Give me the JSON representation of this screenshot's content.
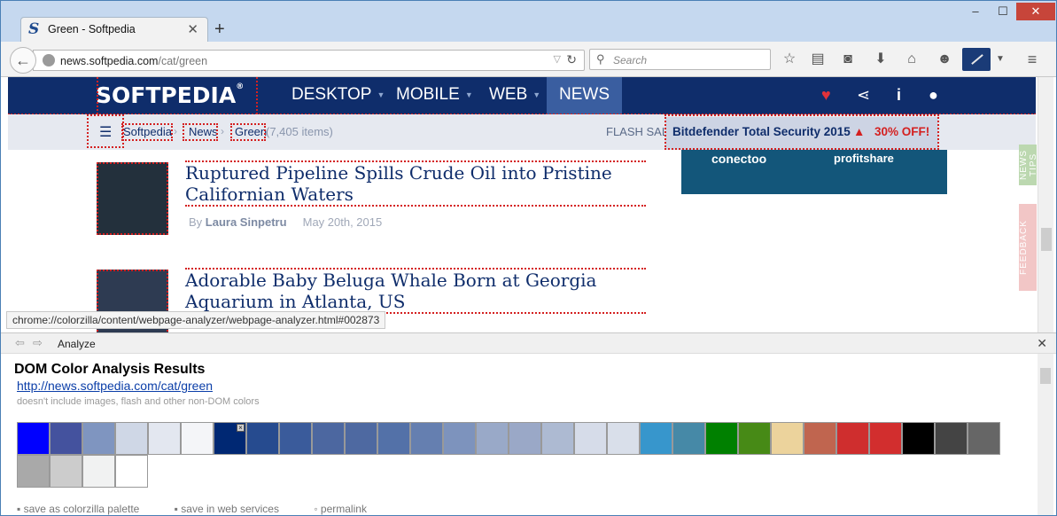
{
  "browser": {
    "tab_title": "Green - Softpedia",
    "tab_favicon": "S",
    "new_tab": "+",
    "url_host": "news.softpedia.com",
    "url_path": "/cat/green",
    "search_placeholder": "Search"
  },
  "site": {
    "logo": "SOFTPEDIA",
    "logo_mark": "®",
    "nav": [
      "DESKTOP",
      "MOBILE",
      "WEB",
      "NEWS"
    ],
    "breadcrumbs": [
      "Softpedia",
      "News",
      "Green"
    ],
    "items_count": "(7,405 items)",
    "flash_label": "FLASH SALE",
    "deal_name": "Bitdefender Total Security 2015",
    "deal_off": "30% OFF!",
    "ad_brand1": "conectoo",
    "ad_brand2": "profitshare",
    "side_tab_1": "NEWS TIPS",
    "side_tab_2": "FEEDBACK",
    "articles": [
      {
        "title": "Ruptured Pipeline Spills Crude Oil into Pristine Californian Waters",
        "by": "By",
        "author": "Laura Sinpetru",
        "date": "May 20th, 2015"
      },
      {
        "title": "Adorable Baby Beluga Whale Born at Georgia Aquarium in Atlanta, US"
      }
    ],
    "status_url": "chrome://colorzilla/content/webpage-analyzer/webpage-analyzer.html#002873"
  },
  "panel": {
    "title": "Analyze",
    "heading": "DOM Color Analysis Results",
    "link": "http://news.softpedia.com/cat/green",
    "note": "doesn't include images, flash and other non-DOM colors",
    "swatches": [
      "#0000ff",
      "#44529e",
      "#7f95c0",
      "#cfd7e6",
      "#e3e7f0",
      "#f4f5f8",
      "#002873",
      "#264b8f",
      "#3a5b9b",
      "#4c67a0",
      "#4e69a1",
      "#5371a8",
      "#657fb0",
      "#7d93bd",
      "#99a9c8",
      "#9aa8c7",
      "#adbad2",
      "#d6dce9",
      "#d9dfea",
      "#3796cc",
      "#4689a7",
      "#008000",
      "#478a16",
      "#ecd39c",
      "#c0654f",
      "#cf2e2e",
      "#d22e2e",
      "#000000",
      "#444444",
      "#666666",
      "#a9a9a9",
      "#cccccc",
      "#f1f2f2",
      "#ffffff"
    ],
    "actions": [
      "save as colorzilla palette",
      "save in web services",
      "permalink"
    ]
  }
}
